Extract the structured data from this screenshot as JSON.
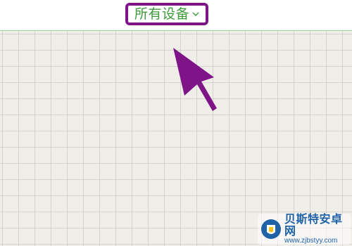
{
  "header": {
    "device_selector": {
      "selected_value": "所有设备",
      "icon": "chevron-down-icon"
    }
  },
  "annotation": {
    "highlight_color": "#7e1487",
    "icon": "pointer-arrow-icon"
  },
  "watermark": {
    "title": "贝斯特安卓网",
    "url": "www.zjbstyy.com",
    "icon": "phone-shield-logo-icon"
  },
  "colors": {
    "label_green": "#3d9a3a",
    "divider_green": "#9fd59a",
    "grid_background": "#efeee9",
    "watermark_blue": "#1f62a8"
  }
}
